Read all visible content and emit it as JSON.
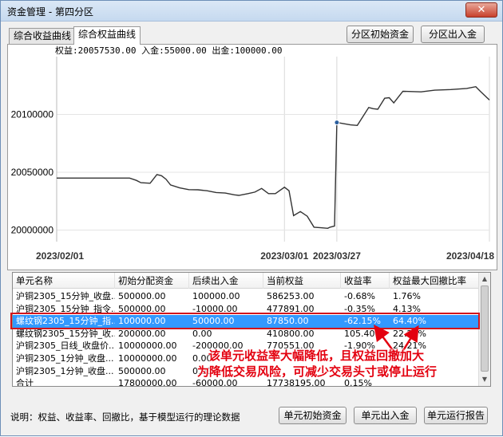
{
  "window": {
    "title": "资金管理 - 第四分区",
    "close_glyph": "✕"
  },
  "tabs": [
    {
      "label": "综合收益曲线",
      "active": false
    },
    {
      "label": "综合权益曲线",
      "active": true
    }
  ],
  "top_buttons": {
    "init_capital": "分区初始资金",
    "transfer": "分区出入金"
  },
  "chart_info": "权益:20057530.00 入金:55000.00 出金:100000.00",
  "chart_data": {
    "type": "line",
    "title": "",
    "xlabel": "",
    "ylabel": "",
    "x_ticks": [
      "2023/02/01",
      "2023/03/01",
      "2023/03/27",
      "2023/04/18"
    ],
    "y_ticks": [
      "20000000",
      "20050000",
      "20100000"
    ],
    "ylim": [
      19990000,
      20150000
    ],
    "grid": true,
    "series": [
      {
        "values": [
          [
            0,
            20045000
          ],
          [
            0.1,
            20045000
          ],
          [
            0.2,
            20045000
          ],
          [
            0.32,
            20045000
          ],
          [
            0.35,
            20043000
          ],
          [
            0.37,
            20041000
          ],
          [
            0.41,
            20040500
          ],
          [
            0.44,
            20048000
          ],
          [
            0.46,
            20047000
          ],
          [
            0.48,
            20044000
          ],
          [
            0.5,
            20039000
          ],
          [
            0.54,
            20036500
          ],
          [
            0.58,
            20035000
          ],
          [
            0.62,
            20034800
          ],
          [
            0.66,
            20034000
          ],
          [
            0.7,
            20032500
          ],
          [
            0.74,
            20032000
          ],
          [
            0.78,
            20030500
          ],
          [
            0.8,
            20030000
          ],
          [
            0.84,
            20031500
          ],
          [
            0.87,
            20032800
          ],
          [
            0.9,
            20036000
          ],
          [
            0.93,
            20031500
          ],
          [
            0.96,
            20031500
          ],
          [
            1.0,
            20037000
          ],
          [
            1.02,
            20034000
          ],
          [
            1.04,
            20012500
          ],
          [
            1.07,
            20016000
          ],
          [
            1.1,
            20012000
          ],
          [
            1.13,
            20002500
          ],
          [
            1.16,
            20002000
          ],
          [
            1.19,
            20001500
          ],
          [
            1.2,
            20002500
          ],
          [
            1.22,
            20003500
          ],
          [
            1.23,
            20093000
          ],
          [
            1.29,
            20091000
          ],
          [
            1.32,
            20090500
          ],
          [
            1.37,
            20106000
          ],
          [
            1.39,
            20105000
          ],
          [
            1.41,
            20104500
          ],
          [
            1.44,
            20114000
          ],
          [
            1.46,
            20114500
          ],
          [
            1.48,
            20110000
          ],
          [
            1.52,
            20120000
          ],
          [
            1.6,
            20119500
          ],
          [
            1.66,
            20121000
          ],
          [
            1.73,
            20121500
          ],
          [
            1.8,
            20122500
          ],
          [
            1.84,
            20124000
          ],
          [
            1.86,
            20120000
          ],
          [
            1.9,
            20112500
          ]
        ]
      }
    ],
    "x_axis_note": "x values in months since 2023/02/01 (0 = 02/01, 1 = 03/01, ~1.23 = 03/27, ~1.90 = 04/18)"
  },
  "table": {
    "columns": [
      "单元名称",
      "初始分配资金",
      "后续出入金",
      "当前权益",
      "收益率",
      "权益最大回撤比率"
    ],
    "rows": [
      [
        "沪铜2305_15分钟_收盘...",
        "500000.00",
        "100000.00",
        "586253.00",
        "-0.68%",
        "1.76%"
      ],
      [
        "沪铜2305_15分钟_指令...",
        "500000.00",
        "-10000.00",
        "477891.00",
        "-0.35%",
        "4.13%"
      ],
      [
        "螺纹钢2305_15分钟_指...",
        "100000.00",
        "50000.00",
        "87850.00",
        "-62.15%",
        "64.40%"
      ],
      [
        "螺纹钢2305_15分钟_收...",
        "200000.00",
        "0.00",
        "410800.00",
        "105.40%",
        "22.24%"
      ],
      [
        "沪铜2305_日线_收盘价...",
        "10000000.00",
        "-200000.00",
        "770551.00",
        "-1.90%",
        "24.21%"
      ],
      [
        "沪铜2305_1分钟_收盘...",
        "10000000.00",
        "0.00",
        "",
        "",
        ""
      ],
      [
        "沪铜2305_1分钟_收盘...",
        "500000.00",
        "0.00",
        "",
        "",
        ""
      ],
      [
        "合计",
        "17800000.00",
        "-60000.00",
        "17738195.00",
        "0.15%",
        ""
      ]
    ],
    "selected_row": 2
  },
  "annotation": {
    "line1": "该单元收益率大幅降低，且权益回撤加大",
    "line2": "为降低交易风险，可减少交易头寸或停止运行"
  },
  "footer": {
    "note": "说明：权益、收益率、回撤比，基于模型运行的理论数据",
    "btn_init": "单元初始资金",
    "btn_transfer": "单元出入金",
    "btn_report": "单元运行报告"
  }
}
